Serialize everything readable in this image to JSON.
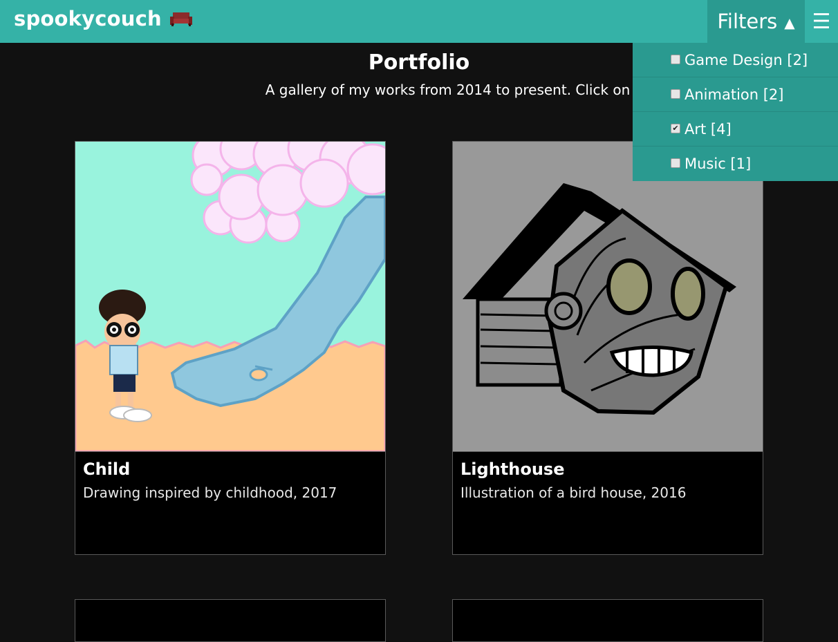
{
  "header": {
    "brand": "spookycouch",
    "filters_label": "Filters",
    "filters_arrow": "▲",
    "menu_icon": "☰"
  },
  "filters": [
    {
      "label": "Game Design [2]",
      "checked": false
    },
    {
      "label": "Animation [2]",
      "checked": false
    },
    {
      "label": "Art [4]",
      "checked": true
    },
    {
      "label": "Music [1]",
      "checked": false
    }
  ],
  "page": {
    "title": "Portfolio",
    "subtitle": "A gallery of my works from 2014 to present. Click on any image to e"
  },
  "cards": [
    {
      "title": "Child",
      "description": "Drawing inspired by childhood, 2017"
    },
    {
      "title": "Lighthouse",
      "description": "Illustration of a bird house, 2016"
    }
  ],
  "colors": {
    "accent": "#35b2a7",
    "accent_dark": "#2a9a90",
    "background": "#111111"
  }
}
